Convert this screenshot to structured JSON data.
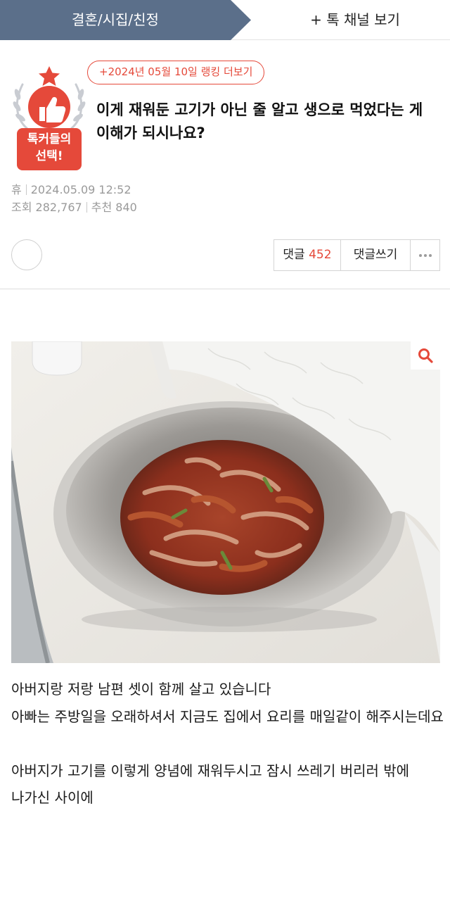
{
  "topbar": {
    "category": "결혼/시집/친정",
    "channel_link": "+ 톡 채널 보기",
    "tab_color": "#5b6f8a"
  },
  "badge": {
    "line1": "톡커들의",
    "line2": "선택!",
    "color": "#e5493a"
  },
  "post": {
    "ranking_link": "+2024년 05월 10일 랭킹 더보기",
    "title": "이게 재워둔 고기가 아닌 줄 알고 생으로 먹었다는 게 이해가 되시나요?",
    "author": "휴",
    "datetime": "2024.05.09 12:52",
    "views_label": "조회",
    "views": "282,767",
    "recommend_label": "추천",
    "recommend": "840"
  },
  "actions": {
    "comments_label": "댓글",
    "comments_count": "452",
    "write_label": "댓글쓰기",
    "more_icon": "more-dots-icon"
  },
  "photo": {
    "zoom_icon": "magnifier-icon"
  },
  "content": {
    "line1": "아버지랑 저랑 남편 셋이 함께 살고 있습니다",
    "line2": "아빠는 주방일을 오래하셔서 지금도 집에서 요리를 매일같이 해주시는데요",
    "line3": "아버지가 고기를 이렇게 양념에 재워두시고 잠시 쓰레기 버리러 밖에 나가신 사이에"
  },
  "colors": {
    "accent": "#e5493a",
    "tab": "#5b6f8a",
    "meta_text": "#9a9a9a"
  }
}
